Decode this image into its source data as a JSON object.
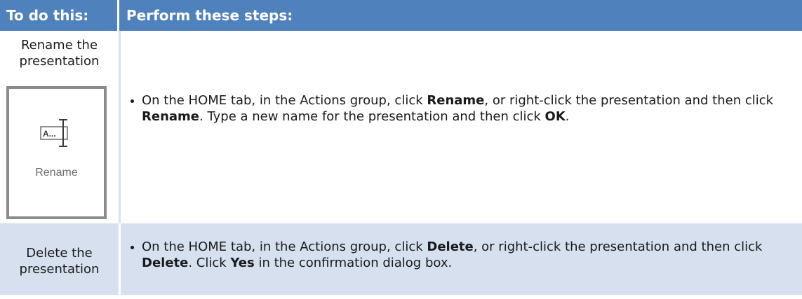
{
  "header": {
    "col1": "To do this:",
    "col2": "Perform these steps:"
  },
  "rows": [
    {
      "action": "Rename the presentation",
      "icon_caption": "Rename",
      "icon": "rename-icon",
      "step": {
        "t1": "On the HOME tab, in the Actions group, click ",
        "b1": "Rename",
        "t2": ", or right-click the presentation and then click ",
        "b2": "Rename",
        "t3": ". Type a new name for the presentation and then click ",
        "b3": "OK",
        "t4": "."
      }
    },
    {
      "action": "Delete the presentation",
      "step": {
        "t1": "On the HOME tab, in the Actions group, click ",
        "b1": "Delete",
        "t2": ", or right-click the presentation and then click ",
        "b2": "Delete",
        "t3": ". Click ",
        "b3": "Yes",
        "t4": " in the confirmation dialog box."
      }
    }
  ],
  "colors": {
    "header_bg": "#4f81bd",
    "alt_row_bg": "#d6e0ef"
  }
}
